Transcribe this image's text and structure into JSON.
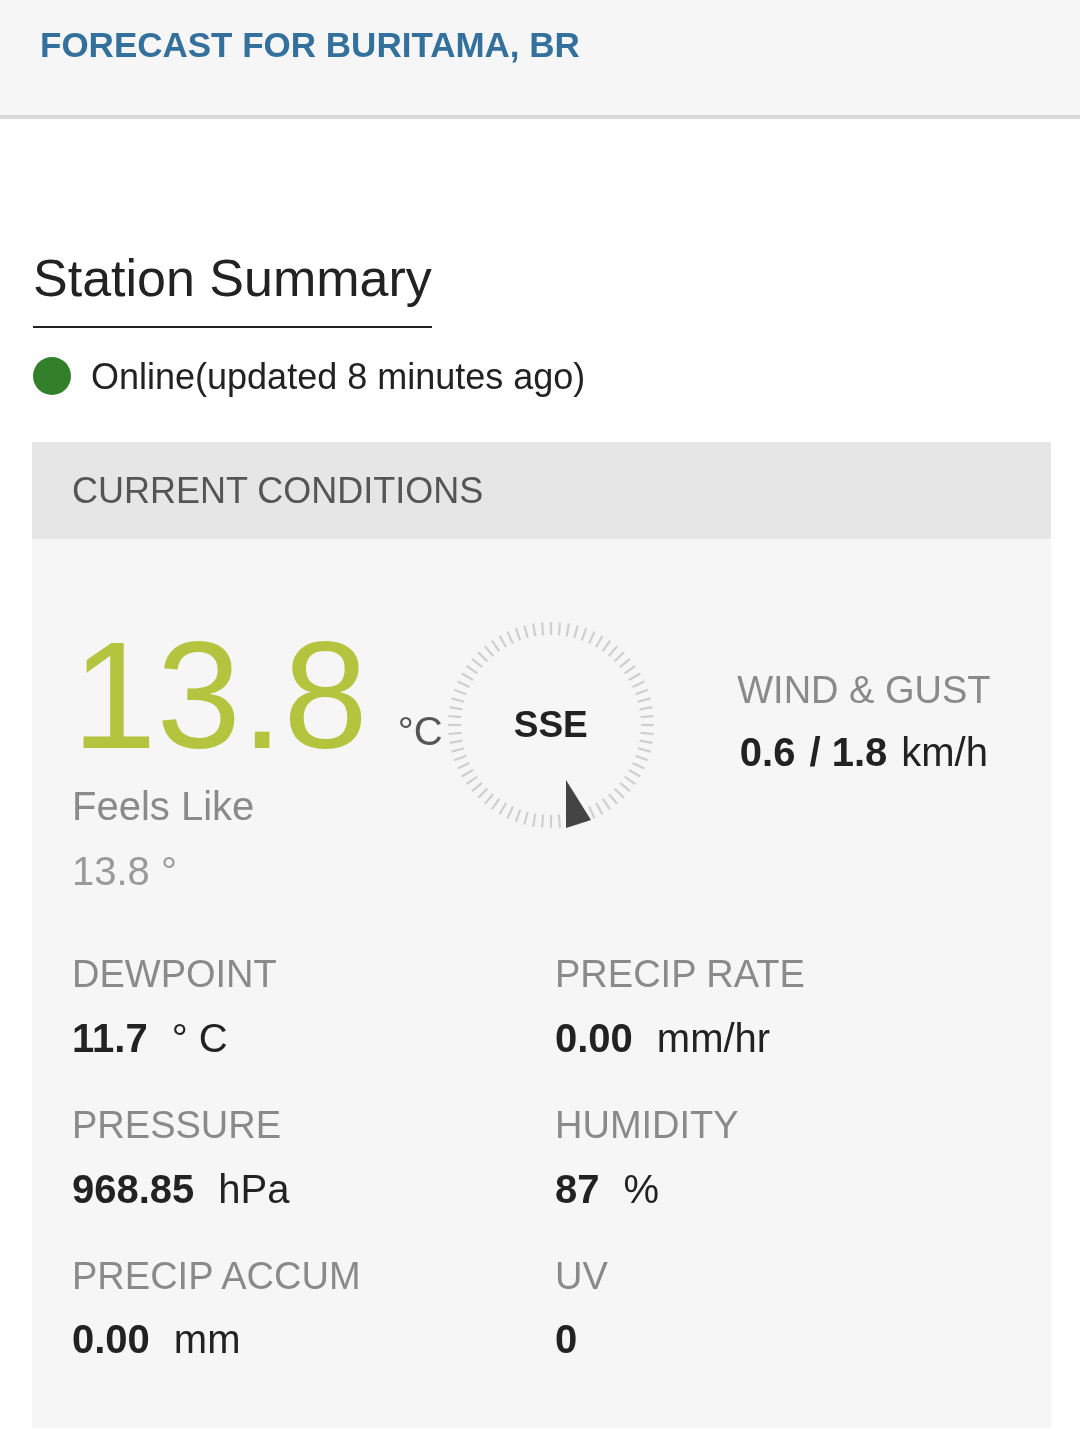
{
  "header": {
    "title": "FORECAST FOR BURITAMA, BR"
  },
  "station_summary": {
    "heading": "Station Summary",
    "status": {
      "color": "#33802a",
      "text": "Online(updated 8 minutes ago)"
    }
  },
  "current_conditions": {
    "title": "CURRENT CONDITIONS",
    "temperature": {
      "value": "13.8",
      "unit": "°C"
    },
    "feels_like": {
      "label": "Feels Like",
      "value": "13.8 °"
    },
    "wind": {
      "direction": "SSE",
      "label": "WIND & GUST",
      "speed": "0.6",
      "gust": "/ 1.8",
      "unit": "km/h"
    },
    "metrics": [
      {
        "label": "DEWPOINT",
        "value": "11.7",
        "unit": "° C"
      },
      {
        "label": "PRECIP RATE",
        "value": "0.00",
        "unit": "mm/hr"
      },
      {
        "label": "PRESSURE",
        "value": "968.85",
        "unit": "hPa"
      },
      {
        "label": "HUMIDITY",
        "value": "87",
        "unit": "%"
      },
      {
        "label": "PRECIP ACCUM",
        "value": "0.00",
        "unit": "mm"
      },
      {
        "label": "UV",
        "value": "0"
      }
    ]
  }
}
